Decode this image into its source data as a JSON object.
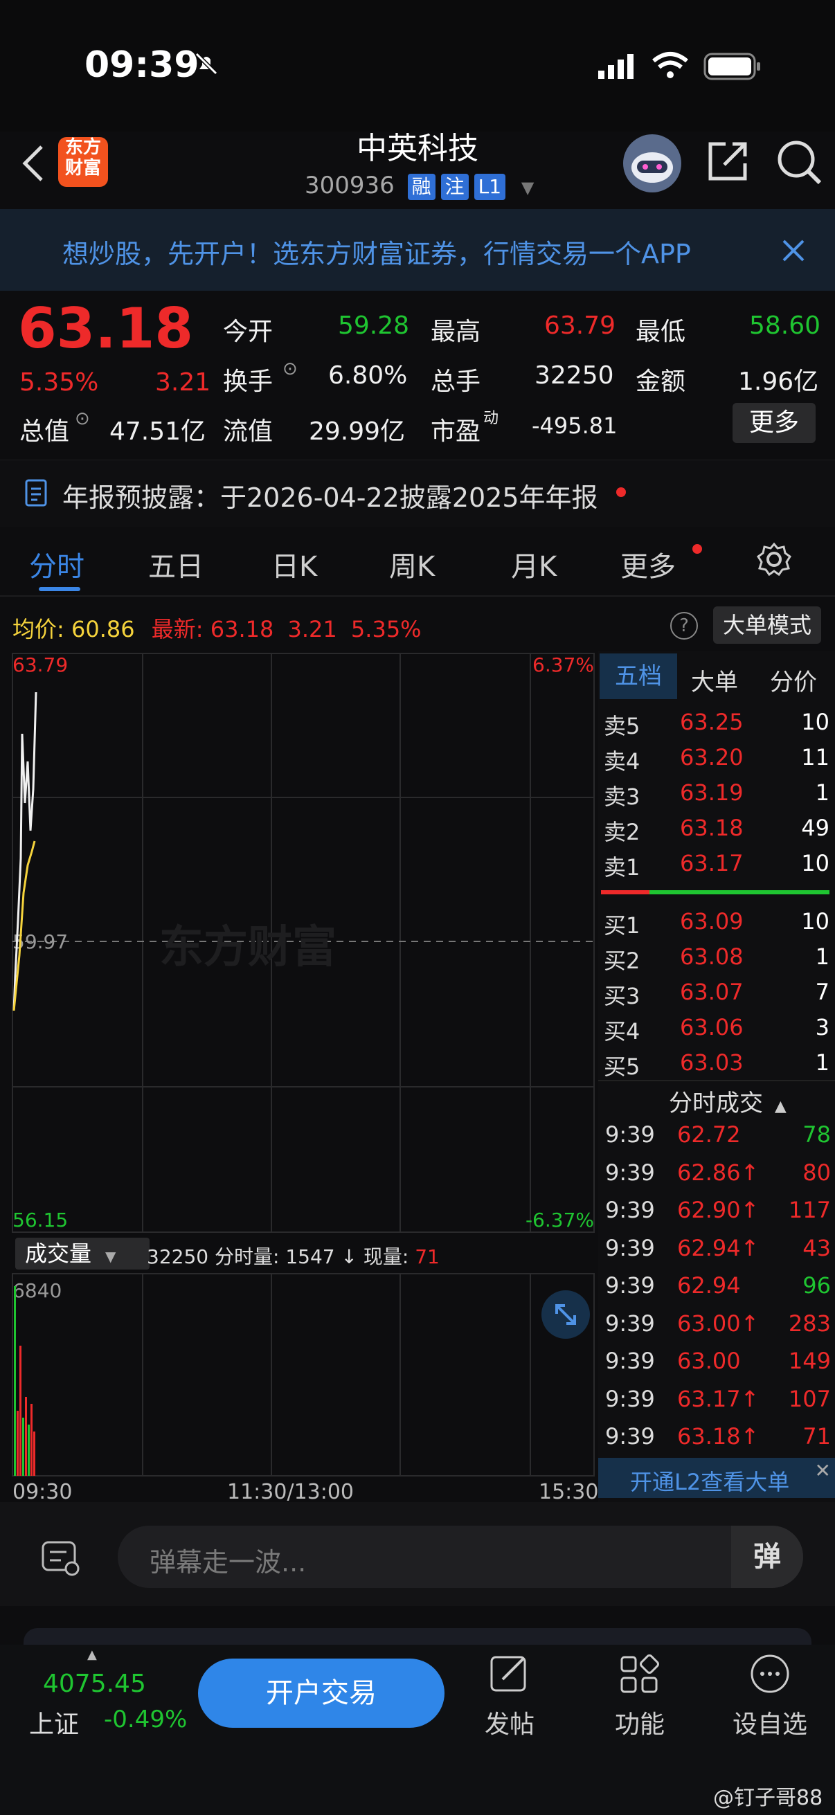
{
  "status_bar": {
    "time": "09:39"
  },
  "header": {
    "logo": "东方财富",
    "title": "中英科技",
    "code": "300936",
    "tags": [
      "融",
      "注",
      "L1"
    ]
  },
  "banner": {
    "text": "想炒股，先开户！选东方财富证券，行情交易一个APP"
  },
  "quote": {
    "price": "63.18",
    "change_pct": "5.35%",
    "change": "3.21",
    "open_label": "今开",
    "open": "59.28",
    "high_label": "最高",
    "high": "63.79",
    "low_label": "最低",
    "low": "58.60",
    "turnover_label": "换手",
    "turnover": "6.80%",
    "volume_label": "总手",
    "volume": "32250",
    "amount_label": "金额",
    "amount": "1.96亿",
    "mktcap_label": "总值",
    "mktcap": "47.51亿",
    "float_label": "流值",
    "float": "29.99亿",
    "pe_label": "市盈",
    "pe_sup": "动",
    "pe": "-495.81",
    "more": "更多"
  },
  "notice": {
    "text": "年报预披露：于2026-04-22披露2025年年报"
  },
  "tabs": [
    "分时",
    "五日",
    "日K",
    "周K",
    "月K",
    "更多"
  ],
  "info_line": {
    "avg_label": "均价:",
    "avg": "60.86",
    "latest_label": "最新:",
    "latest": "63.18",
    "latest_chg": "3.21",
    "latest_pct": "5.35%",
    "mode_button": "大单模式"
  },
  "chart": {
    "top_left": "63.79",
    "top_right": "6.37%",
    "mid_left": "59.97",
    "bottom_left": "56.15",
    "bottom_right": "-6.37%",
    "watermark": "东方财富",
    "time_labels": [
      "09:30",
      "11:30/13:00",
      "15:30"
    ]
  },
  "volume_bar": {
    "selector": "成交量",
    "total": "32250",
    "minute_label": "分时量:",
    "minute": "1547",
    "current_label": "现量:",
    "current": "71",
    "max_label": "6840"
  },
  "order_book": {
    "tabs": [
      "五档",
      "大单",
      "分价"
    ],
    "asks": [
      {
        "label": "卖5",
        "price": "63.25",
        "vol": "10"
      },
      {
        "label": "卖4",
        "price": "63.20",
        "vol": "11"
      },
      {
        "label": "卖3",
        "price": "63.19",
        "vol": "1"
      },
      {
        "label": "卖2",
        "price": "63.18",
        "vol": "49"
      },
      {
        "label": "卖1",
        "price": "63.17",
        "vol": "10"
      }
    ],
    "bids": [
      {
        "label": "买1",
        "price": "63.09",
        "vol": "10"
      },
      {
        "label": "买2",
        "price": "63.08",
        "vol": "1"
      },
      {
        "label": "买3",
        "price": "63.07",
        "vol": "7"
      },
      {
        "label": "买4",
        "price": "63.06",
        "vol": "3"
      },
      {
        "label": "买5",
        "price": "63.03",
        "vol": "1"
      }
    ]
  },
  "ticks": {
    "header": "分时成交",
    "rows": [
      {
        "time": "9:39",
        "price": "62.72",
        "vol": "78",
        "color": "green"
      },
      {
        "time": "9:39",
        "price": "62.86↑",
        "vol": "80",
        "color": "red"
      },
      {
        "time": "9:39",
        "price": "62.90↑",
        "vol": "117",
        "color": "red"
      },
      {
        "time": "9:39",
        "price": "62.94↑",
        "vol": "43",
        "color": "red"
      },
      {
        "time": "9:39",
        "price": "62.94",
        "vol": "96",
        "color": "green"
      },
      {
        "time": "9:39",
        "price": "63.00↑",
        "vol": "283",
        "color": "red"
      },
      {
        "time": "9:39",
        "price": "63.00",
        "vol": "149",
        "color": "red"
      },
      {
        "time": "9:39",
        "price": "63.17↑",
        "vol": "107",
        "color": "red"
      },
      {
        "time": "9:39",
        "price": "63.18↑",
        "vol": "71",
        "color": "red"
      }
    ],
    "l2_banner": "开通L2查看大单"
  },
  "danmu": {
    "placeholder": "弹幕走一波...",
    "send": "弹"
  },
  "bottom": {
    "index_value": "4075.45",
    "index_name": "上证",
    "index_pct": "-0.49%",
    "trade_button": "开户交易",
    "post": "发帖",
    "functions": "功能",
    "watchlist": "设自选",
    "watermark": "@钉子哥88"
  },
  "colors": {
    "up": "#ee2a2a",
    "down": "#1fc531",
    "accent": "#2f86e8",
    "avg_line": "#f5d33c"
  }
}
